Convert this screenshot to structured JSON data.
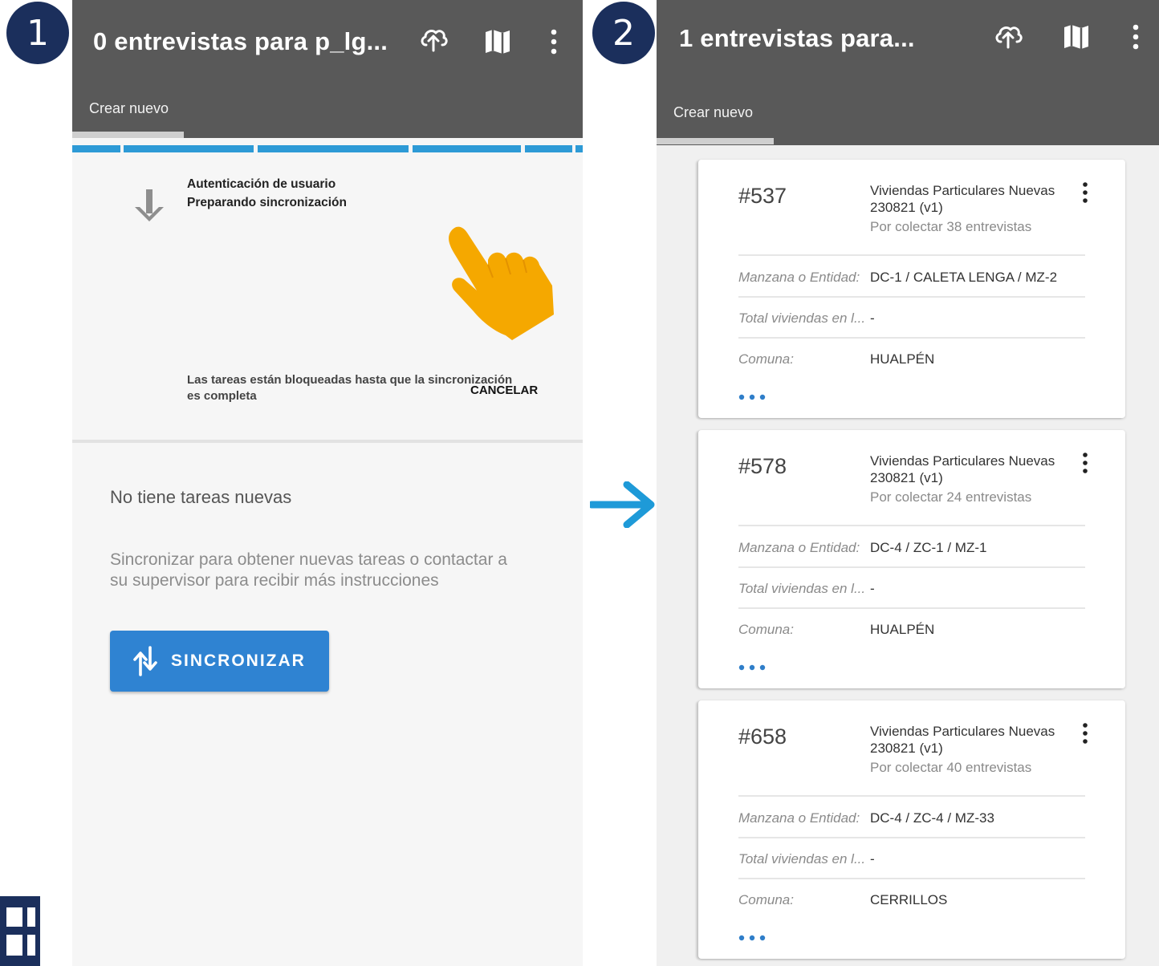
{
  "steps": {
    "first": "1",
    "second": "2"
  },
  "screen1": {
    "title": "0 entrevistas para p_lg...",
    "tab_label": "Crear nuevo",
    "sync_line1": "Autenticación de usuario",
    "sync_line2": "Preparando sincronización",
    "blocked_message_line1": "Las tareas están bloqueadas hasta que la sincronización",
    "blocked_message_line2": "es completa",
    "cancel_label": "CANCELAR",
    "empty_title": "No tiene tareas nuevas",
    "empty_sub_line1": "Sincronizar para obtener nuevas tareas o contactar a",
    "empty_sub_line2": "su supervisor para recibir más instrucciones",
    "sync_button_label": "SINCRONIZAR"
  },
  "screen2": {
    "title": "1 entrevistas para...",
    "tab_label": "Crear nuevo",
    "cards": [
      {
        "number": "#537",
        "title_line1": "Viviendas Particulares Nuevas",
        "title_line2": "230821 (v1)",
        "subtitle": "Por colectar 38 entrevistas",
        "label_manzana": "Manzana o Entidad:",
        "value_manzana": "DC-1 / CALETA LENGA / MZ-2",
        "label_total": "Total viviendas en l...",
        "value_total": "-",
        "label_comuna": "Comuna:",
        "value_comuna": "HUALPÉN"
      },
      {
        "number": "#578",
        "title_line1": "Viviendas Particulares Nuevas",
        "title_line2": "230821 (v1)",
        "subtitle": "Por colectar 24 entrevistas",
        "label_manzana": "Manzana o Entidad:",
        "value_manzana": "DC-4 / ZC-1 / MZ-1",
        "label_total": "Total viviendas en l...",
        "value_total": "-",
        "label_comuna": "Comuna:",
        "value_comuna": "HUALPÉN"
      },
      {
        "number": "#658",
        "title_line1": "Viviendas Particulares Nuevas",
        "title_line2": "230821 (v1)",
        "subtitle": "Por colectar 40 entrevistas",
        "label_manzana": "Manzana o Entidad:",
        "value_manzana": "DC-4 / ZC-4 / MZ-33",
        "label_total": "Total viviendas en l...",
        "value_total": "-",
        "label_comuna": "Comuna:",
        "value_comuna": "CERRILLOS"
      }
    ]
  },
  "icons": {
    "cloud": "cloud-upload-icon",
    "map": "map-icon",
    "more": "more-vert-icon",
    "download": "arrow-down-icon",
    "sync": "sync-arrows-icon",
    "pointer": "hand-pointer-icon",
    "flow": "arrow-right-icon"
  },
  "colors": {
    "appbar": "#595959",
    "badge": "#1b2f5c",
    "button": "#2f83d2",
    "progress": "#2d9ad6",
    "hand": "#f5a800",
    "flow_arrow": "#1e9ad8",
    "dots": "#2f7ec9"
  }
}
